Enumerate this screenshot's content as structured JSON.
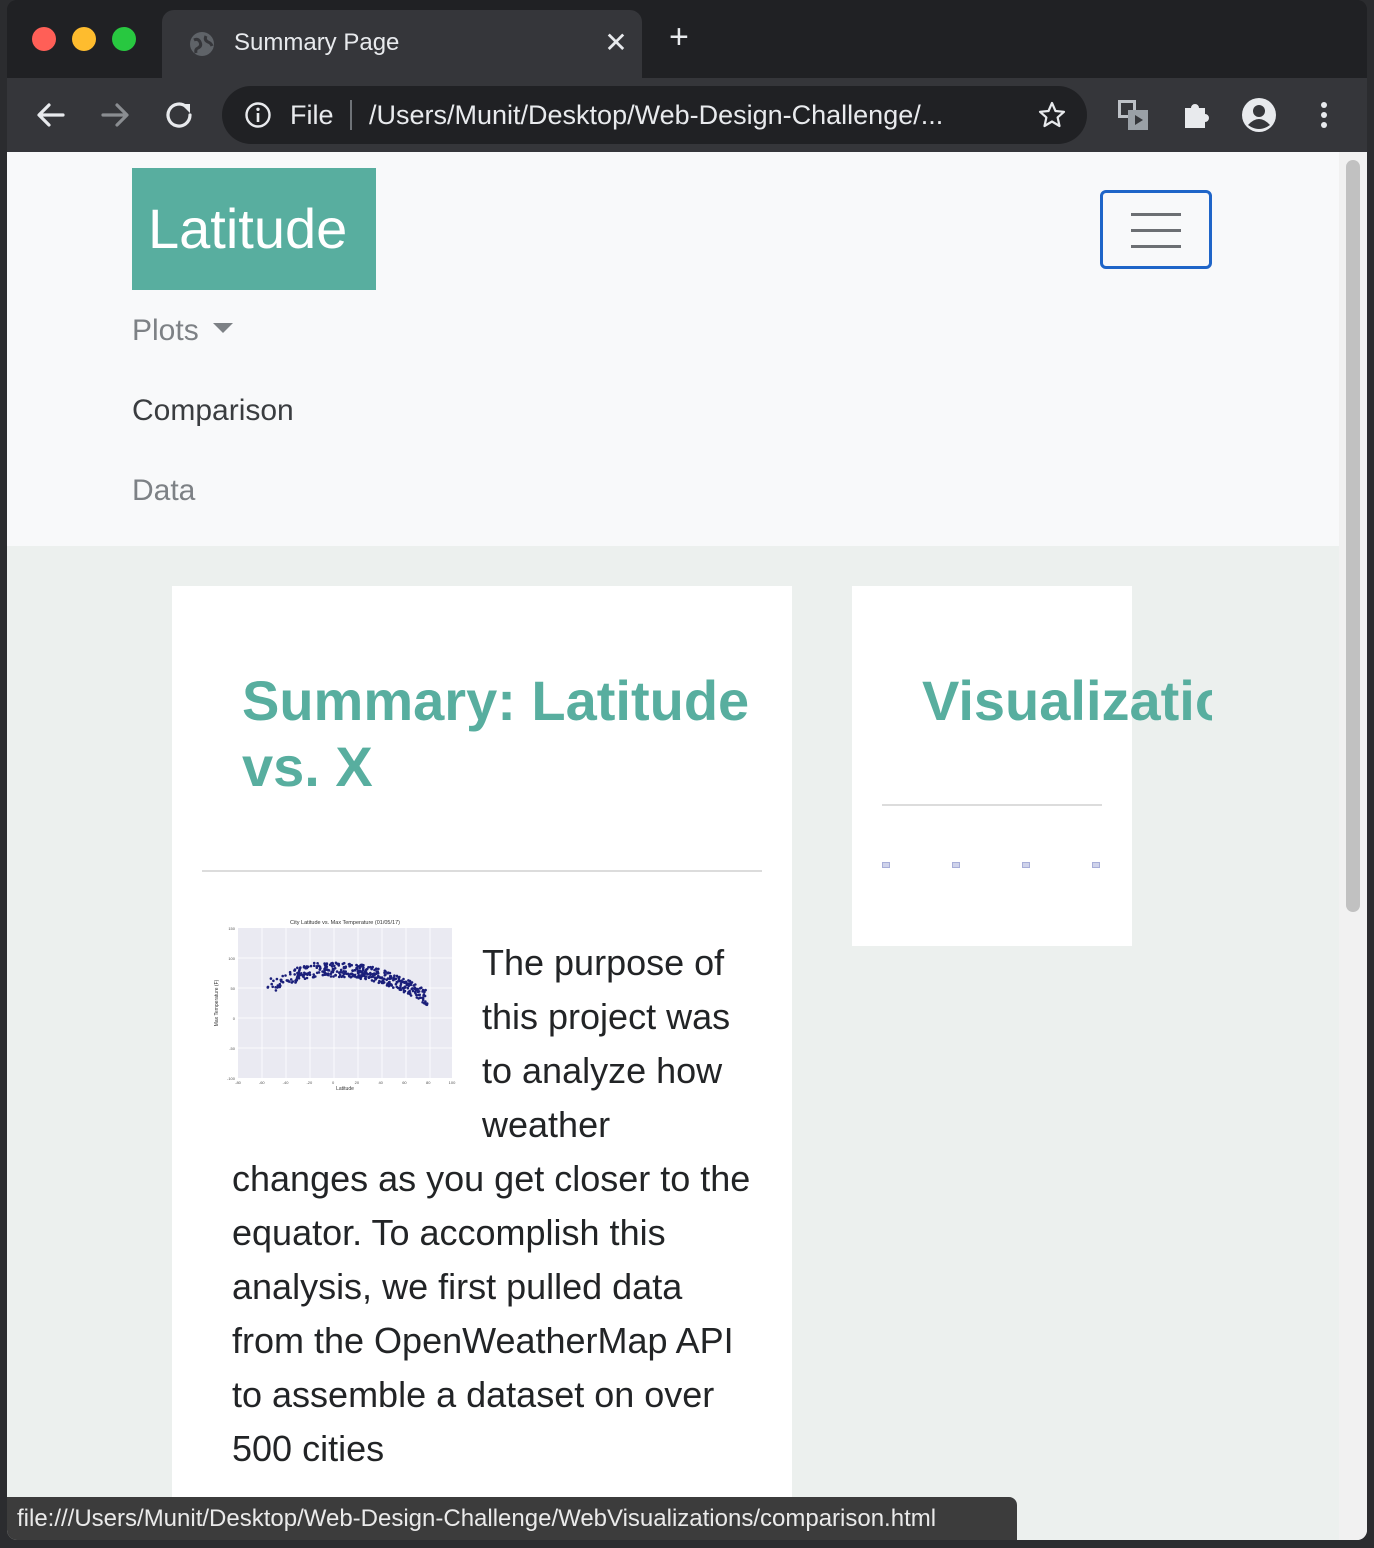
{
  "browser": {
    "tab_title": "Summary Page",
    "tab_close": "✕",
    "new_tab": "+",
    "omnibox_scheme": "File",
    "omnibox_url": "/Users/Munit/Desktop/Web-Design-Challenge/...",
    "status_url": "file:///Users/Munit/Desktop/Web-Design-Challenge/WebVisualizations/comparison.html",
    "traffic_colors": {
      "close": "#ff5f57",
      "minimize": "#febc2e",
      "maximize": "#28c840"
    }
  },
  "navbar": {
    "brand": "Latitude",
    "links": {
      "plots": "Plots",
      "comparison": "Comparison",
      "data": "Data"
    },
    "brand_color": "#58ae9f",
    "toggler_border": "#1f65c8"
  },
  "summary_card": {
    "title": "Summary: Latitude vs. X",
    "paragraph": "The purpose of this project was to analyze how weather changes as you get closer to the equator. To accomplish this analysis, we first pulled data from the OpenWeatherMap API to assemble a dataset on over 500 cities",
    "thumbnail": {
      "title": "City Latitude vs. Max Temperature (01/05/17)",
      "xlabel": "Latitude",
      "ylabel": "Max Temperature (F)",
      "x_ticks": [
        "-80",
        "-60",
        "-40",
        "-20",
        "0",
        "20",
        "40",
        "60",
        "80",
        "100"
      ],
      "y_ticks": [
        "150",
        "100",
        "50",
        "0",
        "-50",
        "-100"
      ],
      "point_color": "#1b1f7a"
    }
  },
  "visualizations_card": {
    "title": "Visualizations"
  }
}
